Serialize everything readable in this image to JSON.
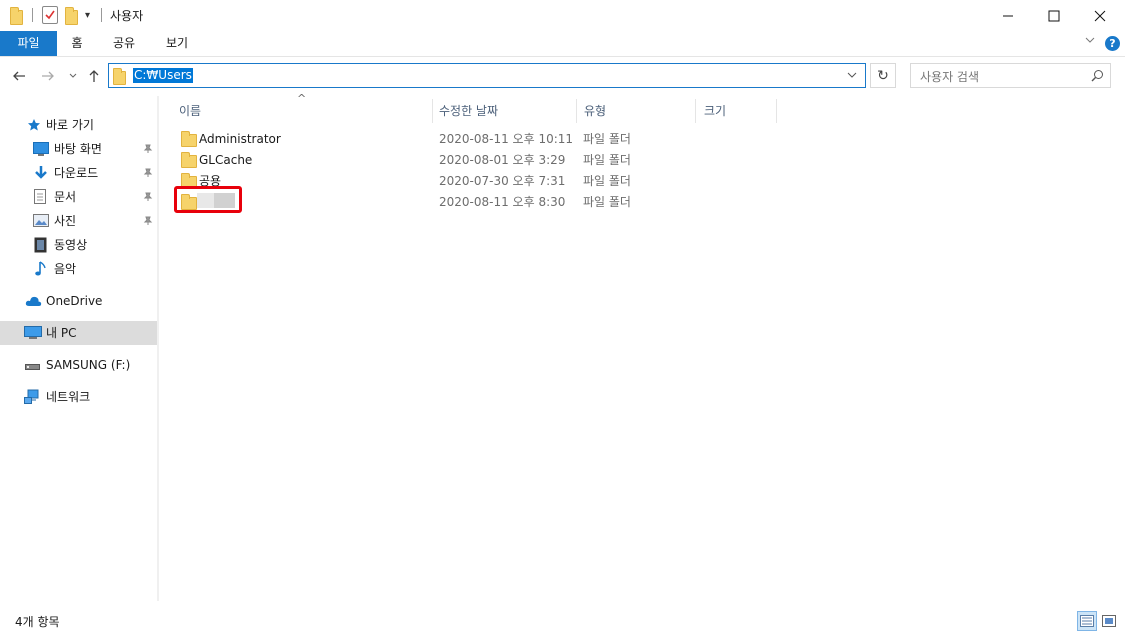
{
  "window": {
    "title": "사용자",
    "minimize": "—",
    "maximize": "☐",
    "close": "✕"
  },
  "ribbon": {
    "tabs": [
      "파일",
      "홈",
      "공유",
      "보기"
    ],
    "help": "?",
    "expand": "⌄"
  },
  "nav": {
    "back": "←",
    "forward": "→",
    "recent": "⌄",
    "up": "↑",
    "address": "C:₩Users",
    "address_dropdown": "⌄",
    "refresh": "↻",
    "search_placeholder": "사용자 검색",
    "search_icon": "⌕"
  },
  "sidebar": {
    "items": [
      {
        "label": "바로 가기",
        "icon": "star-icon"
      },
      {
        "label": "바탕 화면",
        "icon": "desktop-icon",
        "pinned": true
      },
      {
        "label": "다운로드",
        "icon": "download-icon",
        "pinned": true
      },
      {
        "label": "문서",
        "icon": "document-icon",
        "pinned": true
      },
      {
        "label": "사진",
        "icon": "picture-icon",
        "pinned": true
      },
      {
        "label": "동영상",
        "icon": "video-icon"
      },
      {
        "label": "음악",
        "icon": "music-icon"
      },
      {
        "label": "OneDrive",
        "icon": "cloud-icon"
      },
      {
        "label": "내 PC",
        "icon": "pc-icon",
        "selected": true
      },
      {
        "label": "SAMSUNG (F:)",
        "icon": "drive-icon"
      },
      {
        "label": "네트워크",
        "icon": "network-icon"
      }
    ],
    "pin_glyph": "📌"
  },
  "columns": {
    "name": "이름",
    "modified": "수정한 날짜",
    "type": "유형",
    "size": "크기",
    "sort_arrow": "^"
  },
  "files": [
    {
      "name": "Administrator",
      "modified": "2020-08-11 오후 10:11",
      "type": "파일 폴더"
    },
    {
      "name": "GLCache",
      "modified": "2020-08-01 오후 3:29",
      "type": "파일 폴더"
    },
    {
      "name": "공용",
      "modified": "2020-07-30 오후 7:31",
      "type": "파일 폴더"
    },
    {
      "name": "",
      "modified": "2020-08-11 오후 8:30",
      "type": "파일 폴더"
    }
  ],
  "status": {
    "item_count": "4개 항목"
  },
  "colors": {
    "accent": "#1979ca",
    "highlight": "#e8000b",
    "selection": "#0078d7"
  }
}
